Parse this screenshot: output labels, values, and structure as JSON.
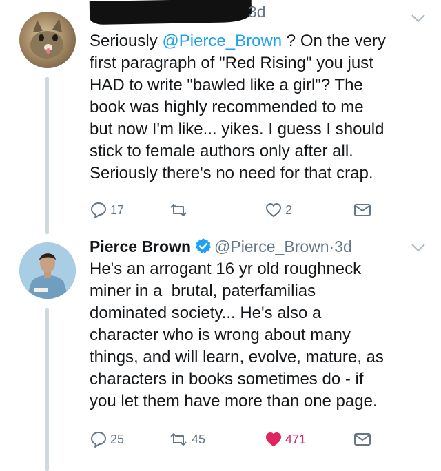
{
  "colors": {
    "link": "#1da1f2",
    "muted": "#657786",
    "like": "#e0245e",
    "text": "#14171a"
  },
  "tweets": [
    {
      "author_redacted": true,
      "time": "3d",
      "body_pre": "Seriously ",
      "mention": "@Pierce_Brown",
      "body_post": " ? On the very\nfirst paragraph of \"Red Rising\" you just\nHAD to write \"bawled like a girl\"? The\nbook was highly recommended to me\nbut now I'm like... yikes. I guess I should\nstick to female authors only after all.\nSeriously there's no need for that crap.",
      "replies": "17",
      "retweets": "",
      "likes": "2",
      "liked": false
    },
    {
      "name": "Pierce Brown",
      "verified": true,
      "handle": "@Pierce_Brown",
      "separator": "·",
      "time": "3d",
      "body": "He's an arrogant 16 yr old roughneck\nminer in a  brutal, paterfamilias\ndominated society... He's also a\ncharacter who is wrong about many\nthings, and will learn, evolve, mature, as\ncharacters in books sometimes do - if\nyou let them have more than one page.",
      "replies": "25",
      "retweets": "45",
      "likes": "471",
      "liked": true
    }
  ],
  "icons": {
    "reply": "reply-icon",
    "retweet": "retweet-icon",
    "like": "heart-icon",
    "message": "envelope-icon",
    "caret": "chevron-down-icon",
    "verified": "verified-badge-icon"
  }
}
